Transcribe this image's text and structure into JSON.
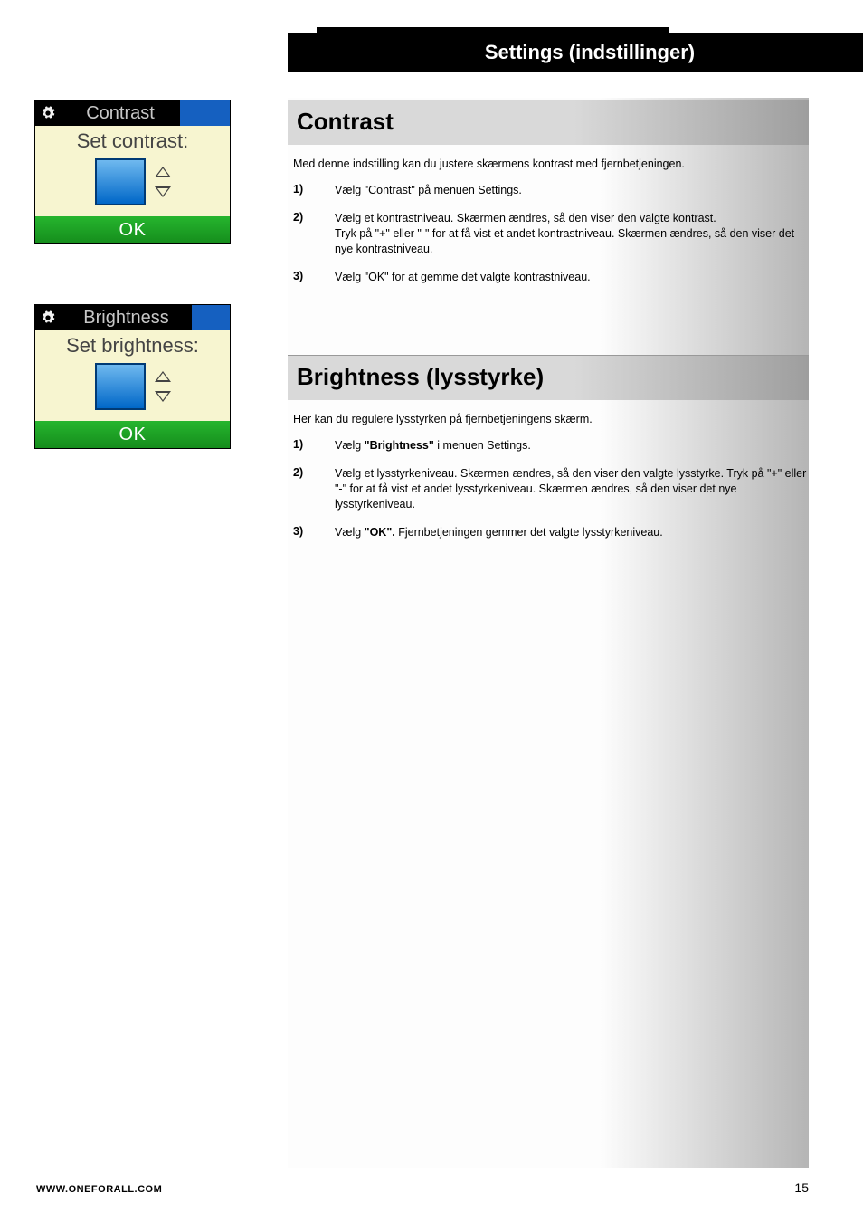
{
  "banner": {
    "title": "Settings (indstillinger)"
  },
  "contrast_device": {
    "header": "Contrast",
    "caption": "Set contrast:",
    "ok": "OK"
  },
  "brightness_device": {
    "header": "Brightness",
    "caption": "Set brightness:",
    "ok": "OK"
  },
  "contrast_section": {
    "title": "Contrast",
    "intro": "Med denne indstilling kan du justere skærmens kontrast med fjernbetjeningen.",
    "steps": {
      "s1_num": "1)",
      "s1": "Vælg \"Contrast\" på menuen Settings.",
      "s2_num": "2)",
      "s2": "Vælg et kontrastniveau. Skærmen ændres, så den viser den valgte kontrast.\nTryk på \"+\" eller \"-\" for at få vist et andet kontrastniveau. Skærmen ændres, så den viser det nye kontrastniveau.",
      "s3_num": "3)",
      "s3": "Vælg \"OK\" for at gemme det valgte kontrastniveau."
    }
  },
  "brightness_section": {
    "title": "Brightness (lysstyrke)",
    "intro": "Her kan du regulere lysstyrken på fjernbetjeningens skærm.",
    "steps": {
      "s1_num": "1)",
      "s1_pre": "Vælg ",
      "s1_bold": "\"Brightness\"",
      "s1_post": " i menuen Settings.",
      "s2_num": "2)",
      "s2": "Vælg et lysstyrkeniveau. Skærmen ændres, så den viser den valgte lysstyrke. Tryk på \"+\" eller \"-\" for at få vist et andet lysstyrkeniveau. Skærmen ændres, så den viser det nye lysstyrkeniveau.",
      "s3_num": "3)",
      "s3_pre": "Vælg ",
      "s3_bold": "\"OK\".",
      "s3_post": " Fjernbetjeningen gemmer det valgte lysstyrkeniveau."
    }
  },
  "footer": {
    "url": "WWW.ONEFORALL.COM",
    "page": "15"
  }
}
